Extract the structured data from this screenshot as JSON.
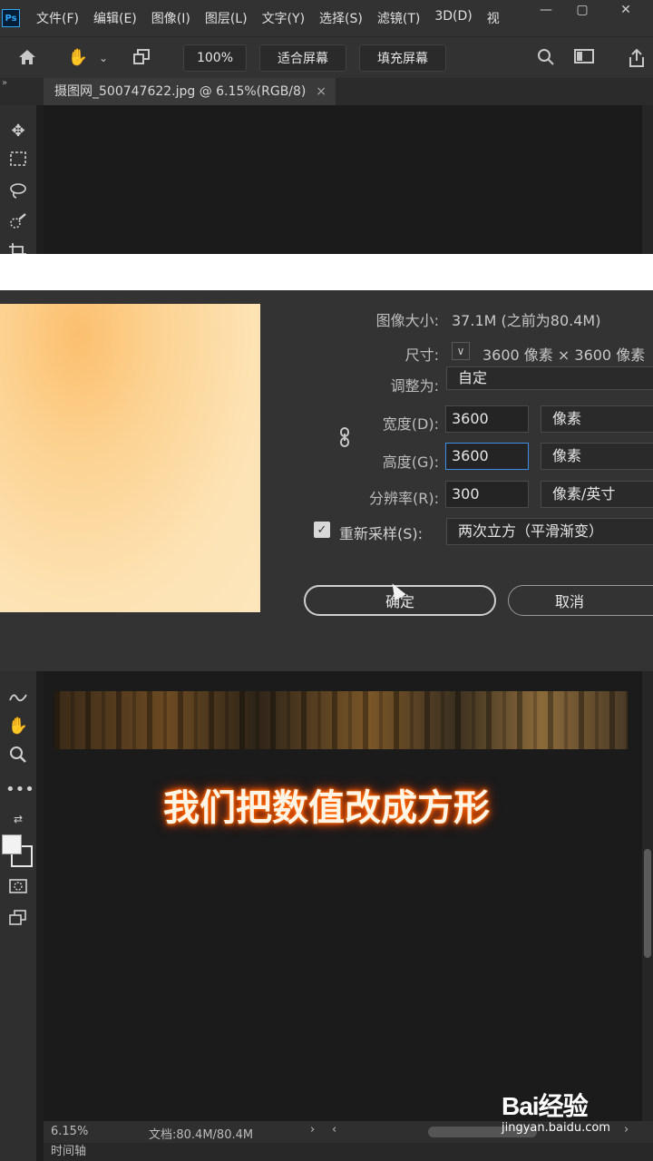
{
  "menubar": {
    "logo": "Ps",
    "items": [
      "文件(F)",
      "编辑(E)",
      "图像(I)",
      "图层(L)",
      "文字(Y)",
      "选择(S)",
      "滤镜(T)",
      "3D(D)",
      "视"
    ]
  },
  "optionsbar": {
    "zoom": "100%",
    "fit_screen": "适合屏幕",
    "fill_screen": "填充屏幕"
  },
  "document": {
    "tab_title": "摄图网_500747622.jpg @ 6.15%(RGB/8)",
    "close_glyph": "×"
  },
  "dialog": {
    "image_size_label": "图像大小:",
    "image_size_value": "37.1M (之前为80.4M)",
    "dimensions_label": "尺寸:",
    "dimensions_value": "3600 像素 × 3600 像素",
    "fit_to_label": "调整为:",
    "fit_to_value": "自定",
    "width_label": "宽度(D):",
    "width_value": "3600",
    "width_unit": "像素",
    "height_label": "高度(G):",
    "height_value": "3600",
    "height_unit": "像素",
    "resolution_label": "分辨率(R):",
    "resolution_value": "300",
    "resolution_unit": "像素/英寸",
    "resample_label": "重新采样(S):",
    "resample_checked": true,
    "resample_value": "两次立方（平滑渐变）",
    "ok_label": "确定",
    "cancel_label": "取消"
  },
  "canvas": {
    "caption": "我们把数值改成方形"
  },
  "statusbar": {
    "zoom": "6.15%",
    "doc_info": "文档:80.4M/80.4M",
    "timeline": "时间轴"
  },
  "watermark": {
    "main": "Bai经验",
    "sub": "jingyan.baidu.com"
  },
  "colors": {
    "accent_focus": "#3d8ee8",
    "caption_glow": "#ff6a00"
  }
}
